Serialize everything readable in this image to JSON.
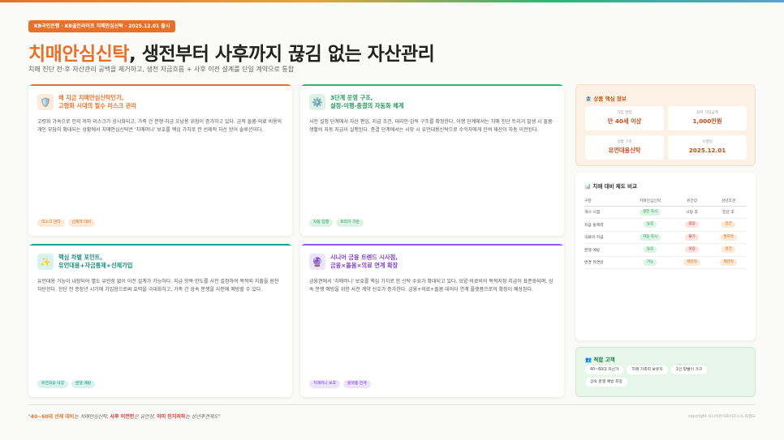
{
  "header": {
    "badge": "KB국민은행 · KB골든라이프 치매안심신탁 · 2025.12.01 출시",
    "title_highlight": "치매안심신탁",
    "title_rest": ", 생전부터 사후까지 끊김 없는 자산관리",
    "subtitle": "치매 진단 전·후 자산관리 공백을 제거하고, 생전 자금흐름 + 사후 이전 설계를 단일 계약으로 통합"
  },
  "cards": [
    {
      "icon": "shield-icon",
      "title_line1": "왜 지금 치매안심신탁인가,",
      "title_line2": "고령화 시대의 필수 리스크 관리",
      "body": "고령화 가속으로 인지 저하 리스크가 상시화되고, 가족 간 분쟁·자금 오남용 위험이 증가하고 있다. 금적 돌봄·의료 비용의 개인 부담이 확대되는 상황에서 치매안심신탁은 '치매머니' 보호를 핵심 가치로 한 선제적 자산 방어 솔루션이다.",
      "tags": [
        "리스크 관리",
        "선제적 대비"
      ],
      "accent": "#e8702a"
    },
    {
      "icon": "gear-icon",
      "title_line1": "3단계 운영 구조,",
      "title_line2": "설정-이행-종결의 자동화 체계",
      "body": "사전 설정 단계에서 자산 편입, 지급 조건, 대리인·감독 구조를 확정한다. 이행 단계에서는 치매 진단 트리거 발생 시 돌봄·생활비 자동 지급이 실행된다. 종결 단계에서는 사망 시 유언대용신탁으로 수익자에게 잔여 재산이 자동 이전된다.",
      "tags": [
        "자동 집행",
        "트리거 기반"
      ],
      "accent": "#2bb673"
    },
    {
      "icon": "sparkle-icon",
      "title_line1": "핵심 차별 포인트,",
      "title_line2": "유언대용+자금통제+선제가입",
      "body": "유언대용 기능이 내장되어 별도 유언장 없이 이전 설계가 가능하다. 지급 항목·한도를 사전 설정하여 목적외 지출을 원천 차단한다. 진단 전 증장년 시기에 가입함으로써 효력을 극대화하고, 가족 간 상속 분쟁을 사전에 예방할 수 있다.",
      "tags": [
        "유언대용 내장",
        "분쟁 예방"
      ],
      "accent": "#1aa391"
    },
    {
      "icon": "crystal-ball-icon",
      "title_line1": "시니어 금융 트렌드 시사점,",
      "title_line2": "금융×돌봄×의료 연계 확장",
      "body": "금융권에서 '치매머니' 보호를 핵심 가치로 한 신탁 수요가 확대되고 있다. 요양·의료비의 목적지정 지급이 표준화되며, 상속 분쟁 예방을 위한 사전 계약 선호가 증가한다. 금융+의료+돌봄 데이터 연계 플랫폼으로의 확장이 예상된다.",
      "tags": [
        "치매머니 보호",
        "플랫폼 연계"
      ],
      "accent": "#8b5cf6"
    }
  ],
  "info": {
    "title": "상품 핵심 정보",
    "cells": [
      {
        "label": "가입 연령",
        "value": "만 40세 이상"
      },
      {
        "label": "최저 가입금액",
        "value": "1,000만원"
      },
      {
        "label": "상품 구조",
        "value": "유언대용신탁"
      },
      {
        "label": "시행일",
        "value": "2025.12.01"
      }
    ]
  },
  "compare": {
    "title": "치매 대비 제도 비교",
    "headers": [
      "구분",
      "치매안심신탁",
      "유언장",
      "성년후견"
    ],
    "rows": [
      {
        "label": "개시 시점",
        "c1": "생전 즉시",
        "c2": "사망 후",
        "c3": "진단 후"
      },
      {
        "label": "지급 통제력",
        "c1": "높음",
        "c2": "없음",
        "c3": "중간"
      },
      {
        "label": "의료비 지급",
        "c1": "자동·즉시",
        "c2": "불가",
        "c3": "절차적"
      },
      {
        "label": "분쟁 예방",
        "c1": "높음",
        "c2": "낮음",
        "c3": "중간"
      },
      {
        "label": "변경 유연성",
        "c1": "가능",
        "c2": "제한적",
        "c3": "제한적"
      }
    ]
  },
  "fit": {
    "title": "적합 고객",
    "chips": [
      "40~60대 자산가",
      "치매 가족력 보유자",
      "1인·맞벌이 가구",
      "상속 분쟁 예방 희망"
    ]
  },
  "footer": {
    "q1": "40~60대 선제 대비",
    "t1": "는 치매안심신탁, ",
    "q2": "사후 이전만",
    "t2": "은 유언장, ",
    "q3": "이미 인지저하",
    "t3": "는 성년후견제도",
    "copyright": "copyright 시니어라이프비즈니스 트렌드"
  },
  "colors": {
    "accent_orange": "#e8702a",
    "green": "#2bb673",
    "teal": "#1aa391",
    "purple": "#8b5cf6"
  }
}
